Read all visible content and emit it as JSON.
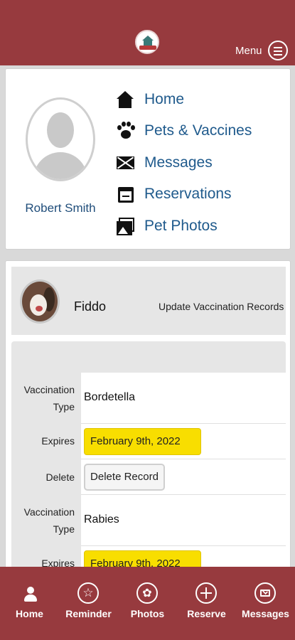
{
  "header": {
    "menu_label": "Menu"
  },
  "profile": {
    "user_name": "Robert Smith",
    "nav": [
      {
        "label": "Home",
        "icon": "home-icon"
      },
      {
        "label": "Pets & Vaccines",
        "icon": "paw-icon"
      },
      {
        "label": "Messages",
        "icon": "envelope-icon"
      },
      {
        "label": "Reservations",
        "icon": "calendar-icon"
      },
      {
        "label": "Pet Photos",
        "icon": "photos-icon"
      }
    ]
  },
  "pet": {
    "name": "Fiddo",
    "update_link": "Update Vaccination Records"
  },
  "vaccinations": {
    "type_label": "Vaccination Type",
    "expires_label": "Expires",
    "delete_label": "Delete",
    "delete_button": "Delete Record",
    "records": [
      {
        "type": "Bordetella",
        "expires": "February 9th, 2022"
      },
      {
        "type": "Rabies",
        "expires": "February 9th, 2022"
      }
    ]
  },
  "tabbar": {
    "items": [
      {
        "label": "Home",
        "icon": "person-icon"
      },
      {
        "label": "Reminder",
        "icon": "star-icon"
      },
      {
        "label": "Photos",
        "icon": "flower-icon"
      },
      {
        "label": "Reserve",
        "icon": "plus-icon"
      },
      {
        "label": "Messages",
        "icon": "mail-icon"
      }
    ]
  },
  "colors": {
    "brand": "#973a3e",
    "link": "#1f5a8c",
    "highlight": "#f8de00"
  }
}
